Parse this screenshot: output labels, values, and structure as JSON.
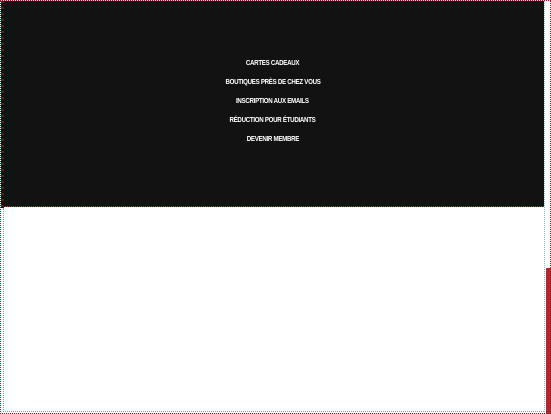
{
  "footer": {
    "links": [
      {
        "label": "CARTES CADEAUX"
      },
      {
        "label": "BOUTIQUES PRÈS DE CHEZ VOUS"
      },
      {
        "label": "INSCRIPTION AUX EMAILS"
      },
      {
        "label": "RÉDUCTION POUR ÉTUDIANTS"
      },
      {
        "label": "DEVENIR MEMBRE"
      }
    ]
  },
  "colors": {
    "footer_background": "#121212",
    "footer_text": "#ffffff",
    "accent": "#b3262c"
  }
}
